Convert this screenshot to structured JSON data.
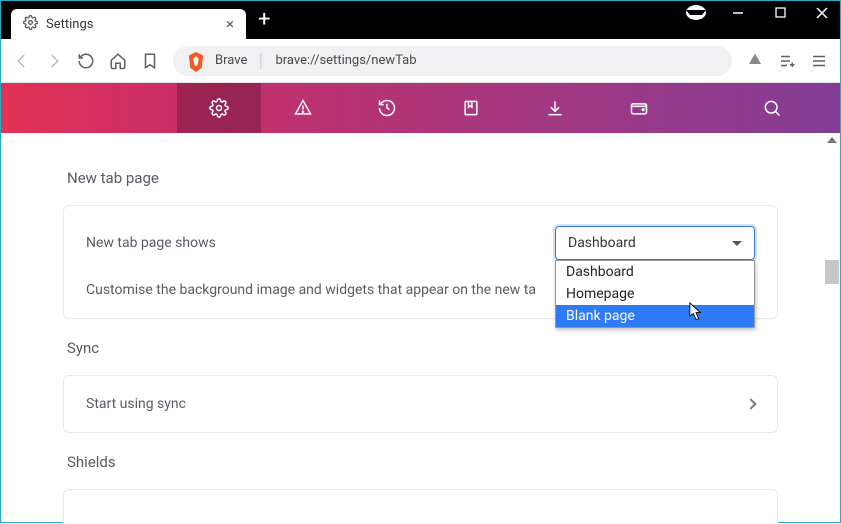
{
  "window": {
    "tab_title": "Settings",
    "new_tab_glyph": "+",
    "close_tab_glyph": "×"
  },
  "toolbar": {
    "product": "Brave",
    "url": "brave://settings/newTab"
  },
  "sections": {
    "newtab": {
      "title": "New tab page",
      "row_label": "New tab page shows",
      "select_value": "Dashboard",
      "sub_text": "Customise the background image and widgets that appear on the new ta",
      "options": [
        "Dashboard",
        "Homepage",
        "Blank page"
      ],
      "selected_option_index": 2
    },
    "sync": {
      "title": "Sync",
      "row_label": "Start using sync"
    },
    "shields": {
      "title": "Shields"
    }
  }
}
